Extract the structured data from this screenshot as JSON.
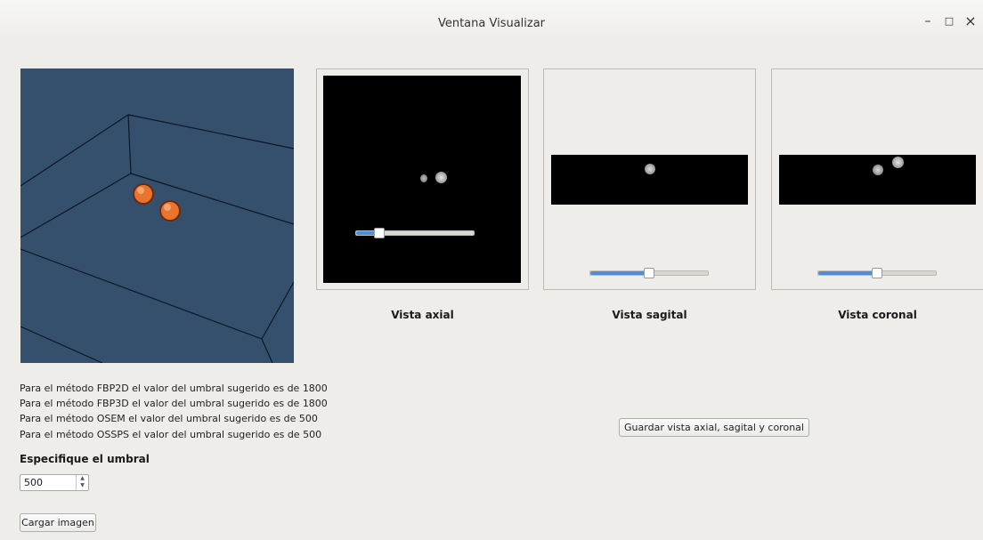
{
  "window": {
    "title": "Ventana Visualizar",
    "minimize": "–",
    "maximize": "□",
    "close": "×"
  },
  "info_lines": [
    "Para el método FBP2D el valor del umbral sugerido es de 1800",
    "Para el método FBP3D el valor del umbral sugerido es de 1800",
    "Para el método OSEM el valor del umbral sugerido es de 500",
    "Para el método OSSPS el valor del umbral sugerido es de 500"
  ],
  "threshold": {
    "label": "Especifique el umbral",
    "value": "500"
  },
  "load_button": "Cargar imagen",
  "save_button": "Guardar vista axial, sagital y coronal",
  "views": [
    {
      "caption": "Vista axial",
      "slider_fraction": 0.2
    },
    {
      "caption": "Vista sagital",
      "slider_fraction": 0.5
    },
    {
      "caption": "Vista coronal",
      "slider_fraction": 0.5
    }
  ],
  "colors": {
    "render_bg": "#35506c",
    "sphere": "#e8742e",
    "slider_accent": "#4a90d9"
  }
}
